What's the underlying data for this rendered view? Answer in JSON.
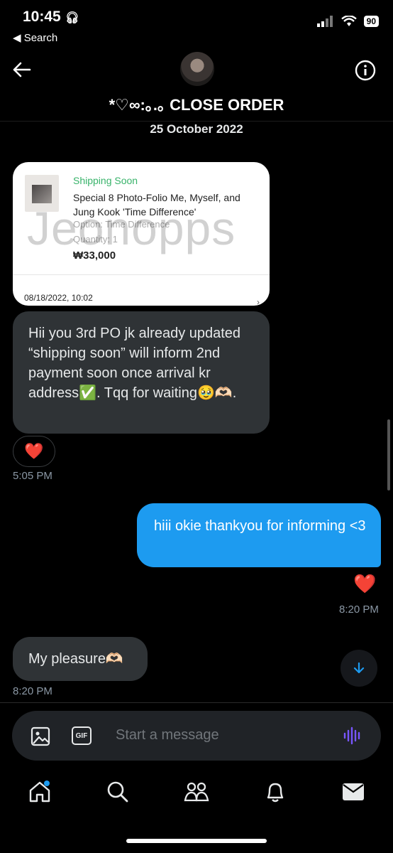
{
  "status_bar": {
    "time": "10:45",
    "back_label": "◀ Search",
    "battery": "90"
  },
  "header": {
    "title": "*♡∞:｡.｡ CLOSE ORDER",
    "avatar": "profile-avatar"
  },
  "conversation": {
    "date_separator": "25 October 2022",
    "order_card": {
      "status": "Shipping Soon",
      "product": "Special 8 Photo-Folio Me, Myself, and Jung Kook 'Time Difference'",
      "option": "Option: Time Difference",
      "quantity": "Quantity: 1",
      "price": "₩33,000",
      "watermark": "Jeonopps",
      "order_date": "08/18/2022, 10:02"
    },
    "messages": [
      {
        "direction": "incoming",
        "text": "Hii you 3rd PO jk already updated “shipping soon” will inform 2nd payment soon once arrival kr address✅. Tqq for waiting🥹🫶🏻.",
        "reaction": "❤️",
        "time": "5:05 PM"
      },
      {
        "direction": "outgoing",
        "text": "hiii okie thankyou for informing <3",
        "reaction": "❤️",
        "time": "8:20 PM"
      },
      {
        "direction": "incoming",
        "text": "My pleasure🫶🏻",
        "time": "8:20 PM"
      }
    ]
  },
  "composer": {
    "placeholder": "Start a message"
  },
  "tabbar": {
    "items": [
      "home-icon",
      "search-icon",
      "communities-icon",
      "notifications-icon",
      "messages-icon"
    ]
  },
  "colors": {
    "accent": "#1d9bf0",
    "background": "#000000",
    "bubble_incoming": "#2f3336",
    "shipping_green": "#38b36a",
    "voice_purple": "#7856ff"
  }
}
